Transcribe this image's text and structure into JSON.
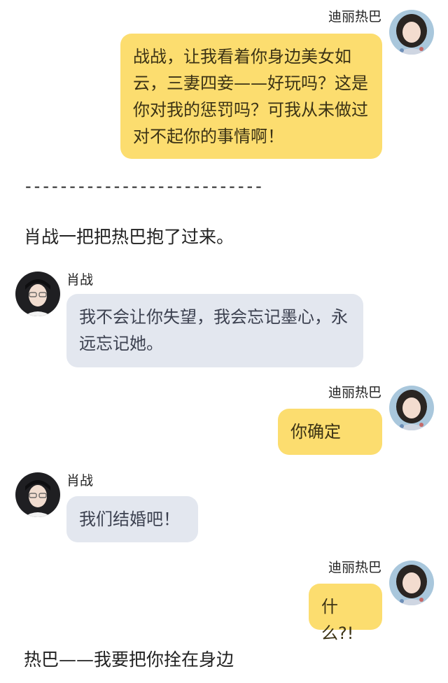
{
  "messages": [
    {
      "side": "right",
      "sender": "迪丽热巴",
      "text": "战战，让我看着你身边美女如云，三妻四妾——好玩吗？这是你对我的惩罚吗？可我从未做过对不起你的事情啊！"
    },
    {
      "side": "left",
      "sender": "肖战",
      "text": "我不会让你失望，我会忘记墨心，永远忘记她。"
    },
    {
      "side": "right",
      "sender": "迪丽热巴",
      "text": "你确定"
    },
    {
      "side": "left",
      "sender": "肖战",
      "text": "我们结婚吧！"
    },
    {
      "side": "right",
      "sender": "迪丽热巴",
      "text": "什么?!"
    }
  ],
  "divider": "---------------------------",
  "narration": [
    "肖战一把把热巴抱了过来。",
    "热巴——我要把你拴在身边"
  ],
  "colors": {
    "right_bubble": "#fcdd6f",
    "left_bubble": "#e3e7ef"
  }
}
